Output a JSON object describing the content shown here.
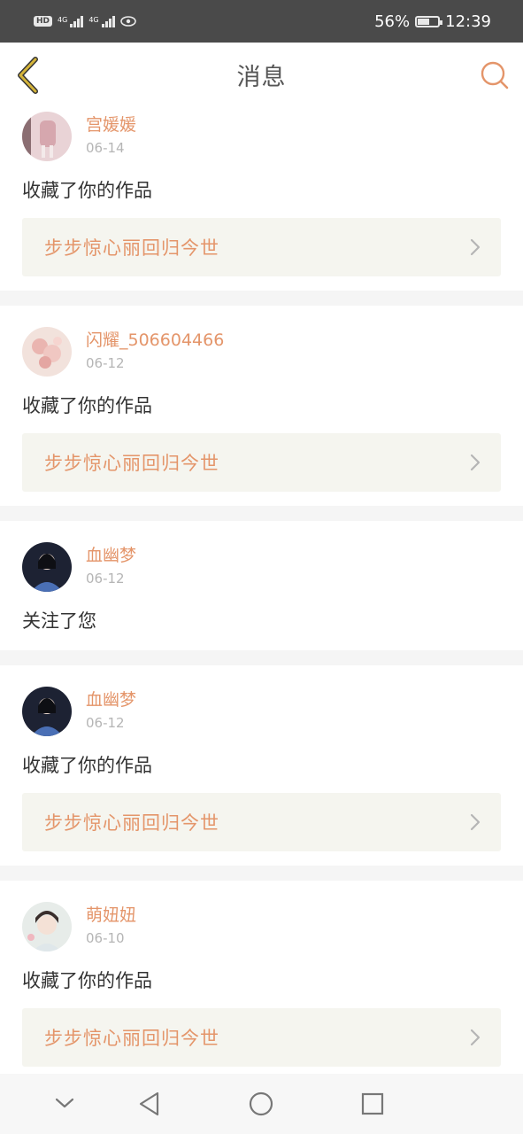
{
  "status_bar": {
    "hd_label": "HD",
    "net1": "4G",
    "net2": "4G",
    "battery_percent": "56%",
    "time": "12:39",
    "icons": [
      "signal-icon",
      "eye-icon",
      "battery-icon"
    ]
  },
  "header": {
    "title": "消息",
    "back_icon": "back-chevron-icon",
    "search_icon": "search-icon"
  },
  "messages": [
    {
      "username": "宫媛媛",
      "date": "06-14",
      "action": "收藏了你的作品",
      "work_title": "步步惊心丽回归今世"
    },
    {
      "username": "闪耀_506604466",
      "date": "06-12",
      "action": "收藏了你的作品",
      "work_title": "步步惊心丽回归今世"
    },
    {
      "username": "血幽梦",
      "date": "06-12",
      "action": "关注了您"
    },
    {
      "username": "血幽梦",
      "date": "06-12",
      "action": "收藏了你的作品",
      "work_title": "步步惊心丽回归今世"
    },
    {
      "username": "萌妞妞",
      "date": "06-10",
      "action": "收藏了你的作品",
      "work_title": "步步惊心丽回归今世"
    }
  ],
  "colors": {
    "accent": "#e4956a",
    "back_icon": "#c9a227",
    "status_bar": "#4a4a4a",
    "work_bg": "#f5f5ef"
  },
  "nav_icons": [
    "collapse-icon",
    "back-triangle-icon",
    "home-circle-icon",
    "recents-square-icon"
  ]
}
